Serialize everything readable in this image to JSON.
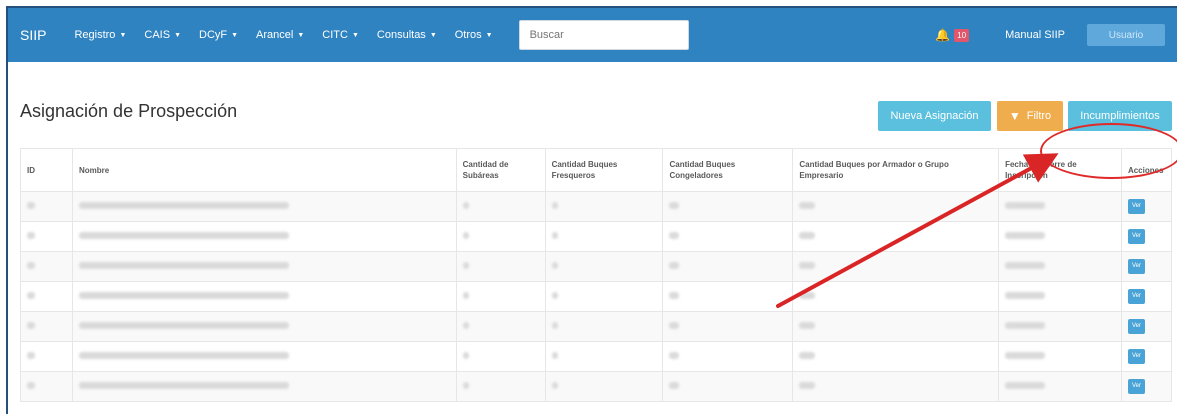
{
  "navbar": {
    "brand": "SIIP",
    "menus": [
      {
        "label": "Registro"
      },
      {
        "label": "CAIS"
      },
      {
        "label": "DCyF"
      },
      {
        "label": "Arancel"
      },
      {
        "label": "CITC"
      },
      {
        "label": "Consultas"
      },
      {
        "label": "Otros"
      }
    ],
    "search_placeholder": "Buscar",
    "notification_count": "10",
    "manual_label": "Manual SIIP",
    "user_label": "Usuario"
  },
  "page": {
    "title": "Asignación de Prospección",
    "buttons": {
      "new": "Nueva Asignación",
      "filter": "Filtro",
      "noncompliance": "Incumplimientos"
    }
  },
  "table": {
    "headers": {
      "id": "ID",
      "name": "Nombre",
      "subareas": "Cantidad de Subáreas",
      "fresqueros": "Cantidad Buques Fresqueros",
      "congeladores": "Cantidad Buques Congeladores",
      "armador": "Cantidad Buques por Armador o Grupo Empresario",
      "fecha": "Fecha de Cierre de Inscripción",
      "acciones": "Acciones"
    },
    "action_label": "Ver",
    "row_count": 7
  },
  "colors": {
    "navbar": "#2f83c0",
    "info_button": "#5bc0de",
    "warning_button": "#f0ad4e",
    "annotation": "#e02a2a"
  }
}
